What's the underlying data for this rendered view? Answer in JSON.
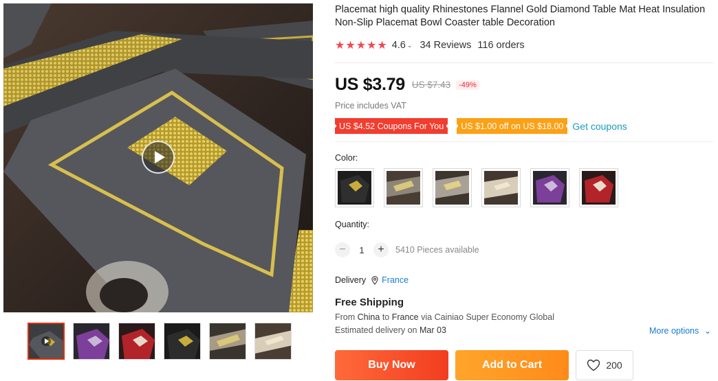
{
  "product": {
    "title": "Placemat high quality Rhinestones Flannel Gold Diamond Table Mat Heat Insulation Non-Slip Placemat Bowl Coaster table Decoration",
    "stars": "★★★★★",
    "rating": "4.6",
    "reviews": "34 Reviews",
    "orders": "116 orders"
  },
  "price": {
    "current": "US $3.79",
    "original": "US $7.43",
    "discount": "-49%",
    "vat_note": "Price includes VAT"
  },
  "coupons": {
    "coupon_1": "US $4.52 Coupons For You",
    "coupon_2": "US $1.00 off on US $18.00",
    "get_link": "Get coupons"
  },
  "color": {
    "label": "Color:",
    "options": [
      "black",
      "gray-gold",
      "gray-light",
      "beige",
      "purple",
      "red"
    ]
  },
  "quantity": {
    "label": "Quantity:",
    "minus": "−",
    "value": "1",
    "plus": "+",
    "available": "5410 Pieces available"
  },
  "delivery": {
    "label": "Delivery",
    "country": "France"
  },
  "shipping": {
    "title": "Free Shipping",
    "from_prefix": "From",
    "from_country": "China",
    "to_word": "to",
    "to_country": "France",
    "via": "via Cainiao Super Economy Global",
    "eta_prefix": "Estimated delivery on",
    "eta_date": "Mar 03",
    "more_options": "More options"
  },
  "actions": {
    "buy_now": "Buy Now",
    "add_to_cart": "Add to Cart",
    "wishlist_count": "200"
  },
  "icons": {
    "play": "play-icon",
    "pin": "location-pin-icon",
    "heart": "heart-icon",
    "chevron": "chevron-down-icon"
  },
  "colors": {
    "accent_red": "#f23d2f",
    "accent_orange": "#fca116",
    "link_blue": "#1a7bd3",
    "star_red": "#f4464f"
  }
}
